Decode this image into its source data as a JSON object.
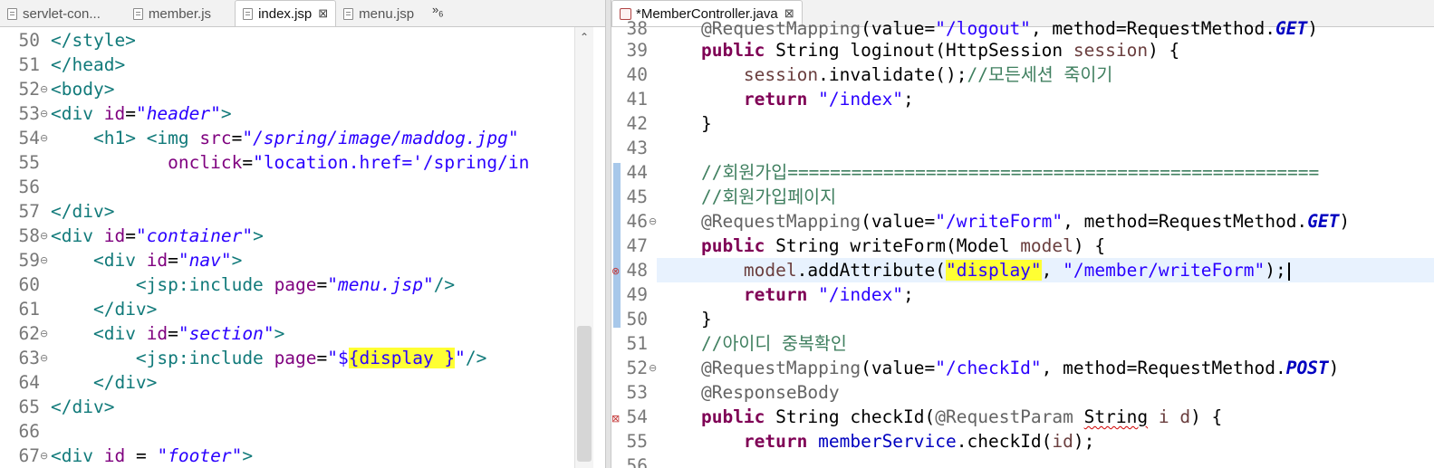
{
  "left_tabs": [
    {
      "label": "servlet-con...",
      "active": false
    },
    {
      "label": "member.js",
      "active": false
    },
    {
      "label": "index.jsp",
      "active": true,
      "close": "⊠"
    },
    {
      "label": "menu.jsp",
      "active": false
    }
  ],
  "left_overflow": {
    "symbol": "»",
    "count": "6"
  },
  "right_tabs": [
    {
      "label": "*MemberController.java",
      "active": true,
      "close": "⊠"
    }
  ],
  "left_code": [
    {
      "n": "50",
      "text": "</style>"
    },
    {
      "n": "51",
      "text": "</head>"
    },
    {
      "n": "52",
      "text": "<body>"
    },
    {
      "n": "53",
      "text": "<div id=\"header\">"
    },
    {
      "n": "54",
      "text": "    <h1> <img src=\"/spring/image/maddog.jpg\""
    },
    {
      "n": "55",
      "text": "           onclick=\"location.href='/spring/in"
    },
    {
      "n": "56",
      "text": ""
    },
    {
      "n": "57",
      "text": "</div>"
    },
    {
      "n": "58",
      "text": "<div id=\"container\">"
    },
    {
      "n": "59",
      "text": "    <div id=\"nav\">"
    },
    {
      "n": "60",
      "text": "        <jsp:include page=\"menu.jsp\"/>"
    },
    {
      "n": "61",
      "text": "    </div>"
    },
    {
      "n": "62",
      "text": "    <div id=\"section\">"
    },
    {
      "n": "63",
      "text": "        <jsp:include page=\"${display }\"/>"
    },
    {
      "n": "64",
      "text": "    </div>"
    },
    {
      "n": "65",
      "text": "</div>"
    },
    {
      "n": "66",
      "text": ""
    },
    {
      "n": "67",
      "text": "<div id = \"footer\">"
    }
  ],
  "right_code": [
    {
      "n": "38",
      "text": "    @RequestMapping(value=\"/logout\", method=RequestMethod.GET)"
    },
    {
      "n": "39",
      "text": "    public String loginout(HttpSession session) {"
    },
    {
      "n": "40",
      "text": "        session.invalidate();//모든세션 죽이기"
    },
    {
      "n": "41",
      "text": "        return \"/index\";"
    },
    {
      "n": "42",
      "text": "    }"
    },
    {
      "n": "43",
      "text": ""
    },
    {
      "n": "44",
      "text": "    //회원가입=================================================="
    },
    {
      "n": "45",
      "text": "    //회원가입페이지"
    },
    {
      "n": "46",
      "text": "    @RequestMapping(value=\"/writeForm\", method=RequestMethod.GET)"
    },
    {
      "n": "47",
      "text": "    public String writeForm(Model model) {"
    },
    {
      "n": "48",
      "text": "        model.addAttribute(\"display\", \"/member/writeForm\");"
    },
    {
      "n": "49",
      "text": "        return \"/index\";"
    },
    {
      "n": "50",
      "text": "    }"
    },
    {
      "n": "51",
      "text": "    //아이디 중복확인"
    },
    {
      "n": "52",
      "text": "    @RequestMapping(value=\"/checkId\", method=RequestMethod.POST)"
    },
    {
      "n": "53",
      "text": "    @ResponseBody"
    },
    {
      "n": "54",
      "text": "    public String checkId(@RequestParam String i d) {"
    },
    {
      "n": "55",
      "text": "        return memberService.checkId(id);"
    },
    {
      "n": "56",
      "text": ""
    }
  ],
  "colors": {
    "highlight": "#ffff33",
    "current_line": "#e8f2fe",
    "change_bar": "#a8c8ea"
  }
}
